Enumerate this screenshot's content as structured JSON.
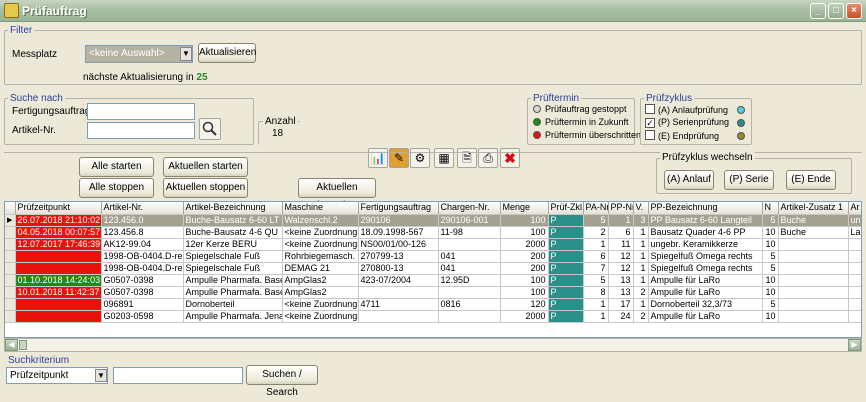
{
  "window": {
    "title": "Prüfauftrag"
  },
  "filter": {
    "group_label": "Filter",
    "messplatz_label": "Messplatz",
    "messplatz_value": "<keine Auswahl>",
    "refresh_button": "Aktualisieren",
    "next_refresh_label": "nächste Aktualisierung in",
    "next_refresh_value": "25"
  },
  "suche": {
    "group_label": "Suche nach",
    "auftrag_label": "Fertigungsauftrag",
    "artikel_label": "Artikel-Nr.",
    "auftrag_value": "",
    "artikel_value": ""
  },
  "anzahl": {
    "label": "Anzahl",
    "value": "18"
  },
  "prueftermin": {
    "group_label": "Prüftermin",
    "items": [
      {
        "label": "Prüfauftrag gestoppt",
        "color": "#d8d8d8"
      },
      {
        "label": "Prüftermin in Zukunft",
        "color": "#1c8a1c"
      },
      {
        "label": "Prüftermin überschritten",
        "color": "#e8140c"
      }
    ]
  },
  "pruefzyklus": {
    "group_label": "Prüfzyklus",
    "items": [
      {
        "label": "(A) Anlaufprüfung",
        "checked": false,
        "color": "#4fd0e0"
      },
      {
        "label": "(P) Serienprüfung",
        "checked": true,
        "color": "#2b8f8a"
      },
      {
        "label": "(E) Endprüfung",
        "checked": false,
        "color": "#9a8a2c"
      }
    ]
  },
  "actions": {
    "alle_starten": "Alle starten",
    "alle_stoppen": "Alle stoppen",
    "aktuellen_starten": "Aktuellen starten",
    "aktuellen_stoppen": "Aktuellen stoppen",
    "aktuellen_beenden": "Aktuellen beenden"
  },
  "zyklus_wechseln": {
    "group_label": "Prüfzyklus wechseln",
    "anlauf": "(A) Anlauf",
    "serie": "(P) Serie",
    "ende": "(E) Ende"
  },
  "table": {
    "columns": [
      "",
      "Prüfzeitpunkt",
      "Artikel-Nr.",
      "Artikel-Bezeichnung",
      "Maschine",
      "Fertigungsauftrag",
      "Chargen-Nr.",
      "Menge",
      "Prüf-Zkl.",
      "PA-Nr.",
      "PP-Nr.",
      "V.",
      "PP-Bezeichnung",
      "N",
      "Artikel-Zusatz 1",
      "Ar"
    ],
    "rows": [
      {
        "time": "26.07.2018 21:10:02",
        "status": "red",
        "artikel": "123.456.0",
        "bez": "Buche-Bausatz 6-60 LT",
        "maschine": "Walzenschl.2",
        "auftrag": "290106",
        "charge": "290106-001",
        "menge": "100",
        "zkl": "P",
        "pa": "5",
        "pp": "1",
        "v": "3",
        "ppbez": "PP Bausatz 6-60 Langteil",
        "n": "5",
        "zusatz": "Buche",
        "ar": "un",
        "selected": true
      },
      {
        "time": "04.05.2018 00:07:57",
        "status": "red",
        "artikel": "123.456.8",
        "bez": "Buche-Bausatz 4-6 QU",
        "maschine": "<keine Zuordnung>",
        "auftrag": "18.09.1998-567",
        "charge": "11-98",
        "menge": "100",
        "zkl": "P",
        "pa": "2",
        "pp": "6",
        "v": "1",
        "ppbez": "Bausatz Quader 4-6 PP",
        "n": "10",
        "zusatz": "Buche",
        "ar": "La",
        "selected": false
      },
      {
        "time": "12.07.2017 17:46:39",
        "status": "red",
        "artikel": "AK12-99.04",
        "bez": "12er Kerze BERU",
        "maschine": "<keine Zuordnung>",
        "auftrag": "NS00/01/00-126",
        "charge": "",
        "menge": "2000",
        "zkl": "P",
        "pa": "1",
        "pp": "11",
        "v": "1",
        "ppbez": "ungebr. Keramikkerze",
        "n": "10",
        "zusatz": "",
        "ar": "",
        "selected": false
      },
      {
        "time": "",
        "status": "red",
        "artikel": "1998-OB-0404.D-re",
        "bez": "Spiegelschale Fuß",
        "maschine": "Rohrbiegemasch.",
        "auftrag": "270799-13",
        "charge": "041",
        "menge": "200",
        "zkl": "P",
        "pa": "6",
        "pp": "12",
        "v": "1",
        "ppbez": "Spiegelfuß Omega rechts",
        "n": "5",
        "zusatz": "",
        "ar": "",
        "selected": false
      },
      {
        "time": "",
        "status": "red",
        "artikel": "1998-OB-0404.D-re",
        "bez": "Spiegelschale Fuß",
        "maschine": "DEMAG 21",
        "auftrag": "270800-13",
        "charge": "041",
        "menge": "200",
        "zkl": "P",
        "pa": "7",
        "pp": "12",
        "v": "1",
        "ppbez": "Spiegelfuß Omega rechts",
        "n": "5",
        "zusatz": "",
        "ar": "",
        "selected": false
      },
      {
        "time": "01.10.2018 14:24:03",
        "status": "green",
        "artikel": "G0507-0398",
        "bez": "Ampulle Pharmafa. Basel",
        "maschine": "AmpGlas2",
        "auftrag": "423-07/2004",
        "charge": "12.95D",
        "menge": "100",
        "zkl": "P",
        "pa": "5",
        "pp": "13",
        "v": "1",
        "ppbez": "Ampulle für LaRo",
        "n": "10",
        "zusatz": "",
        "ar": "",
        "selected": false
      },
      {
        "time": "10.01.2018 11:42:37",
        "status": "red",
        "artikel": "G0507-0398",
        "bez": "Ampulle Pharmafa. Basel",
        "maschine": "AmpGlas2",
        "auftrag": "",
        "charge": "",
        "menge": "100",
        "zkl": "P",
        "pa": "8",
        "pp": "13",
        "v": "2",
        "ppbez": "Ampulle für LaRo",
        "n": "10",
        "zusatz": "",
        "ar": "",
        "selected": false
      },
      {
        "time": "",
        "status": "red",
        "artikel": "096891",
        "bez": "Dornoberteil",
        "maschine": "<keine Zuordnung>",
        "auftrag": "4711",
        "charge": "0816",
        "menge": "120",
        "zkl": "P",
        "pa": "1",
        "pp": "17",
        "v": "1",
        "ppbez": "Dornoberteil 32,3/73",
        "n": "5",
        "zusatz": "",
        "ar": "",
        "selected": false
      },
      {
        "time": "",
        "status": "red",
        "artikel": "G0203-0598",
        "bez": "Ampulle Pharmafa. Jena",
        "maschine": "<keine Zuordnung>",
        "auftrag": "",
        "charge": "",
        "menge": "2000",
        "zkl": "P",
        "pa": "1",
        "pp": "24",
        "v": "2",
        "ppbez": "Ampulle für LaRo",
        "n": "10",
        "zusatz": "",
        "ar": "",
        "selected": false
      }
    ]
  },
  "suchkriterium": {
    "group_label": "Suchkriterium",
    "select_value": "Prüfzeitpunkt",
    "search_value": "",
    "search_button": "Suchen / Search"
  }
}
